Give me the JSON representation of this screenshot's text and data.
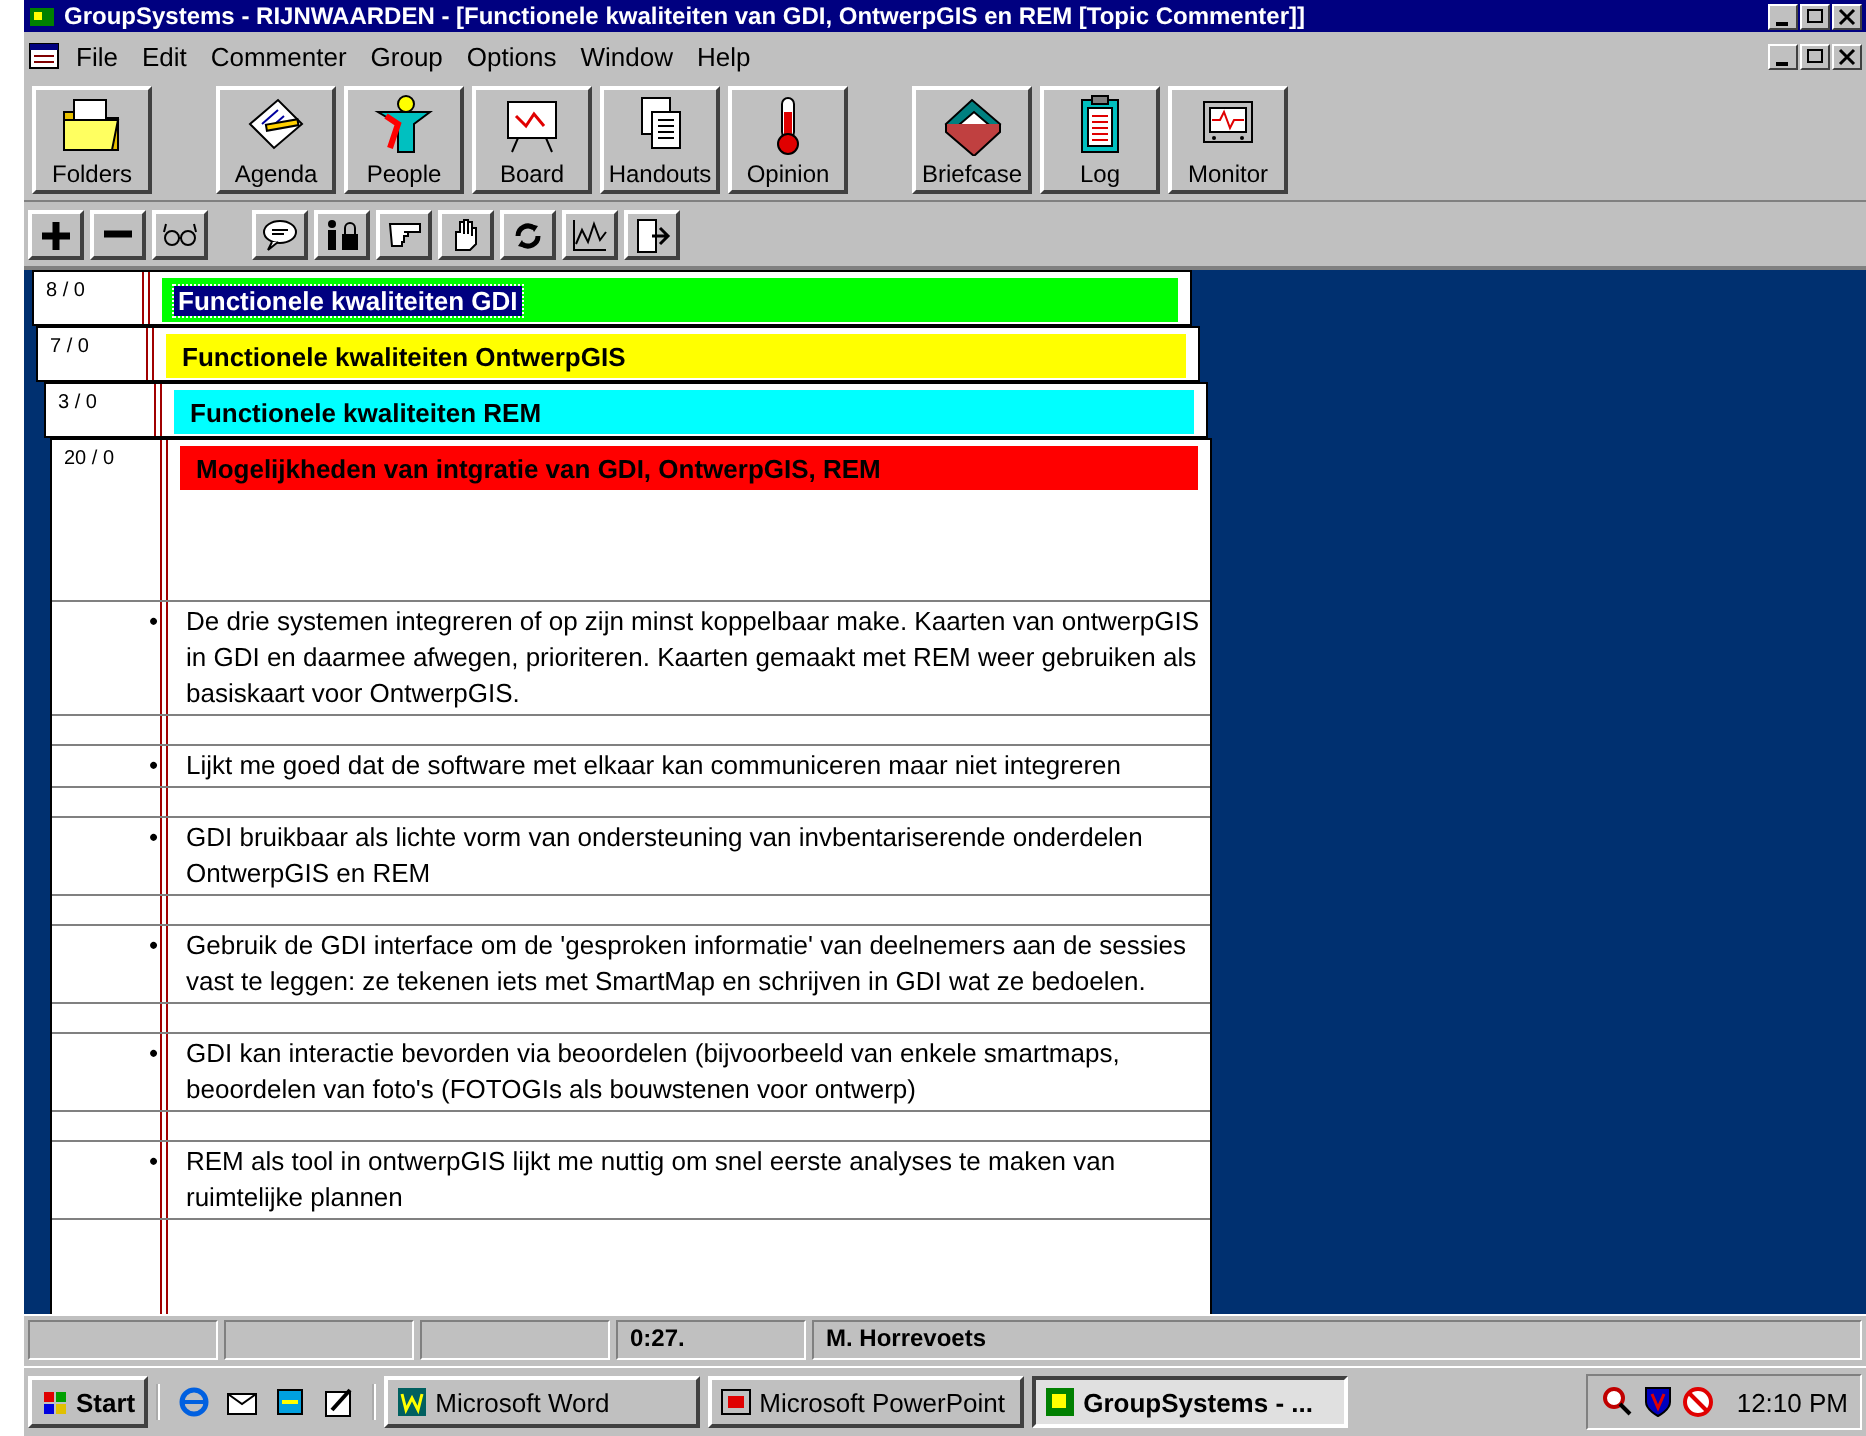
{
  "window": {
    "title": "GroupSystems - RIJNWAARDEN - [Functionele kwaliteiten van GDI, OntwerpGIS en REM [Topic Commenter]]"
  },
  "menu": [
    "File",
    "Edit",
    "Commenter",
    "Group",
    "Options",
    "Window",
    "Help"
  ],
  "toolbar": [
    [
      {
        "label": "Folders"
      }
    ],
    [
      {
        "label": "Agenda"
      },
      {
        "label": "People"
      },
      {
        "label": "Board"
      },
      {
        "label": "Handouts"
      },
      {
        "label": "Opinion"
      }
    ],
    [
      {
        "label": "Briefcase"
      },
      {
        "label": "Log"
      },
      {
        "label": "Monitor"
      }
    ]
  ],
  "topics": [
    {
      "count": "8 / 0",
      "title": "Functionele kwaliteiten GDI",
      "color": "#00ff00",
      "selected": true
    },
    {
      "count": "7 / 0",
      "title": "Functionele kwaliteiten OntwerpGIS",
      "color": "#ffff00",
      "selected": false
    },
    {
      "count": "3 / 0",
      "title": "Functionele kwaliteiten REM",
      "color": "#00ffff",
      "selected": false
    },
    {
      "count": "20 / 0",
      "title": "Mogelijkheden van intgratie van GDI, OntwerpGIS, REM",
      "color": "#ff0000",
      "selected": false,
      "comments": [
        {
          "bullet": "•",
          "text": "De drie systemen integreren of op zijn minst koppelbaar make. Kaarten van ontwerpGIS in GDI en daarmee afwegen, prioriteren. Kaarten gemaakt met REM  weer gebruiken als basiskaart voor OntwerpGIS."
        },
        {
          "bullet": "•",
          "text": "Lijkt me goed dat de software met elkaar kan communiceren maar niet integreren"
        },
        {
          "bullet": "•",
          "text": "GDI bruikbaar als lichte vorm van ondersteuning van invbentariserende onderdelen OntwerpGIS en REM"
        },
        {
          "bullet": "•",
          "text": "Gebruik de GDI interface om de 'gesproken informatie' van deelnemers aan de sessies vast te leggen: ze tekenen iets met SmartMap en schrijven in GDI wat ze bedoelen."
        },
        {
          "bullet": "•",
          "text": "GDI kan interactie bevorden via beoordelen (bijvoorbeeld van enkele smartmaps, beoordelen van foto's (FOTOGIs als bouwstenen voor ontwerp)"
        },
        {
          "bullet": "•",
          "text": "REM als tool in ontwerpGIS lijkt me nuttig om snel eerste analyses te maken van ruimtelijke plannen"
        }
      ]
    }
  ],
  "status_bar": [
    "0:27.",
    "M. Horrevoets"
  ],
  "taskbar": {
    "start": "Start",
    "tasks": [
      {
        "label": "Microsoft Word",
        "selected": false
      },
      {
        "label": "Microsoft PowerPoint",
        "selected": false
      },
      {
        "label": "GroupSystems - ...",
        "selected": true
      }
    ],
    "clock": "12:10 PM"
  }
}
